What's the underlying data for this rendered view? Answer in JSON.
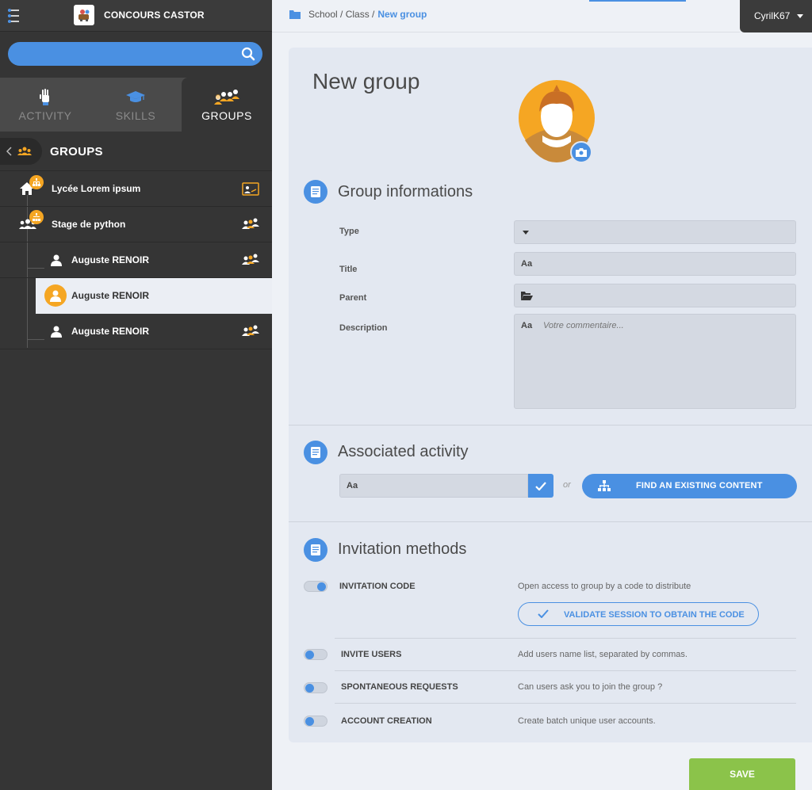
{
  "app": {
    "title": "CONCOURS CASTOR"
  },
  "search": {
    "placeholder": ""
  },
  "tabs": [
    {
      "label": "ACTIVITY",
      "icon": "raised-hand-icon"
    },
    {
      "label": "SKILLS",
      "icon": "graduation-cap-icon"
    },
    {
      "label": "GROUPS",
      "icon": "group-people-icon",
      "active": true
    }
  ],
  "groups": {
    "title": "GROUPS",
    "items": [
      {
        "label": "Lycée Lorem ipsum",
        "icon": "home-icon"
      },
      {
        "label": "Stage de python",
        "icon": "users-icon"
      },
      {
        "label": "Auguste RENOIR",
        "icon": "user-icon"
      },
      {
        "label": "Auguste RENOIR",
        "icon": "user-icon",
        "selected": true
      },
      {
        "label": "Auguste RENOIR",
        "icon": "user-icon"
      }
    ]
  },
  "breadcrumb": {
    "path": "School / Class /",
    "current": "New group"
  },
  "user": {
    "name": "CyrilK67"
  },
  "page": {
    "title": "New group"
  },
  "group_info": {
    "title": "Group informations",
    "type_label": "Type",
    "title_label": "Title",
    "title_prefix": "Aa",
    "parent_label": "Parent",
    "description_label": "Description",
    "description_prefix": "Aa",
    "description_placeholder": "Votre commentaire..."
  },
  "activity": {
    "title": "Associated activity",
    "input_prefix": "Aa",
    "or_text": "or",
    "find_button": "FIND AN EXISTING CONTENT"
  },
  "invitation": {
    "title": "Invitation methods",
    "methods": [
      {
        "label": "INVITATION CODE",
        "desc": "Open access to group by a code to distribute",
        "on": true
      },
      {
        "label": "INVITE USERS",
        "desc": "Add users name list, separated by commas.",
        "on": false
      },
      {
        "label": "SPONTANEOUS REQUESTS",
        "desc": "Can users ask you to join the group ?",
        "on": false
      },
      {
        "label": "ACCOUNT CREATION",
        "desc": "Create batch unique user accounts.",
        "on": false
      }
    ],
    "validate_button": "VALIDATE SESSION TO OBTAIN THE CODE"
  },
  "actions": {
    "save": "SAVE"
  },
  "colors": {
    "accent": "#4a90e2",
    "orange": "#f5a623",
    "save_green": "#8bc34a",
    "sidebar_bg": "#353535"
  }
}
